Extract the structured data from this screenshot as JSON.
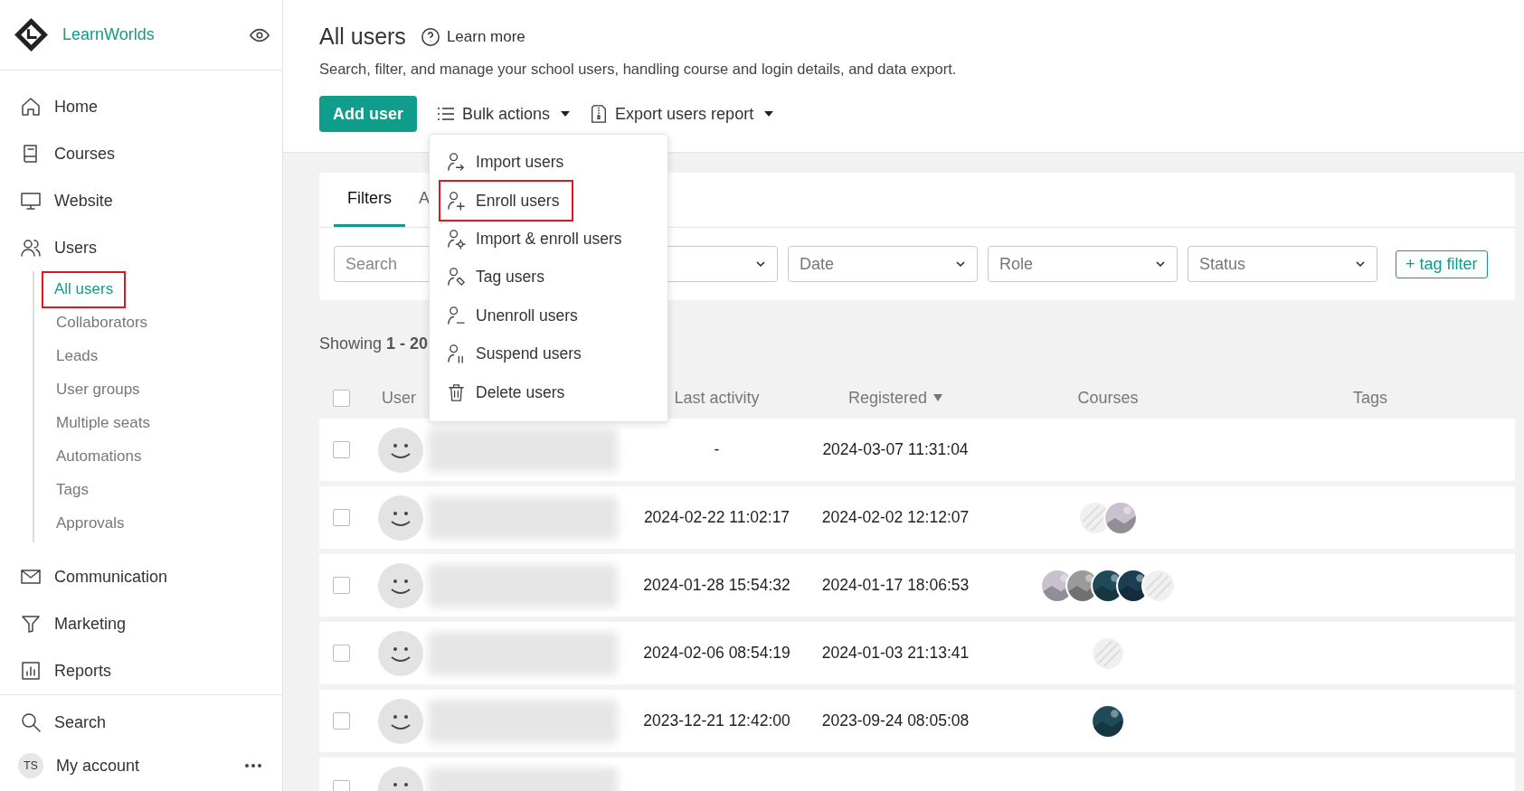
{
  "sidebar": {
    "logo": {
      "text": "LearnWorlds"
    },
    "items": [
      {
        "label": "Home"
      },
      {
        "label": "Courses"
      },
      {
        "label": "Website"
      },
      {
        "label": "Users",
        "expanded": true,
        "children": [
          {
            "label": "All users",
            "selected": true,
            "highlighted": true
          },
          {
            "label": "Collaborators",
            "selected": false,
            "highlighted": false
          },
          {
            "label": "Leads",
            "selected": false,
            "highlighted": false
          },
          {
            "label": "User groups",
            "selected": false,
            "highlighted": false
          },
          {
            "label": "Multiple seats",
            "selected": false,
            "highlighted": false
          },
          {
            "label": "Automations",
            "selected": false,
            "highlighted": false
          },
          {
            "label": "Tags",
            "selected": false,
            "highlighted": false
          },
          {
            "label": "Approvals",
            "selected": false,
            "highlighted": false
          }
        ]
      },
      {
        "label": "Communication"
      },
      {
        "label": "Marketing"
      },
      {
        "label": "Reports"
      }
    ],
    "footer": [
      {
        "label": "Search"
      },
      {
        "label": "My account",
        "initials": "TS"
      }
    ]
  },
  "header": {
    "title": "All users",
    "help_link": "Learn more",
    "description": "Search, filter, and manage your school users, handling course and login details, and data export.",
    "add_button": "Add user",
    "bulk_button": "Bulk actions",
    "export_button": "Export users report"
  },
  "bulk_menu": {
    "open": true,
    "items": [
      {
        "label": "Import users",
        "highlighted": false
      },
      {
        "label": "Enroll users",
        "highlighted": true
      },
      {
        "label": "Import & enroll users",
        "highlighted": false
      },
      {
        "label": "Tag users",
        "highlighted": false
      },
      {
        "label": "Unenroll users",
        "highlighted": false
      },
      {
        "label": "Suspend users",
        "highlighted": false
      },
      {
        "label": "Delete users",
        "highlighted": false
      }
    ]
  },
  "filters": {
    "tabs": [
      {
        "label": "Filters",
        "selected": true
      },
      {
        "label": "A",
        "selected": false
      }
    ],
    "fields": [
      {
        "kind": "search",
        "placeholder": "Search"
      },
      {
        "kind": "select"
      },
      {
        "kind": "select",
        "placeholder": "Date"
      },
      {
        "kind": "select",
        "placeholder": "Role"
      },
      {
        "kind": "select",
        "placeholder": "Status"
      }
    ],
    "tag_filter": "+ tag filter"
  },
  "showing": "Showing **1 - 20**",
  "table": {
    "all_selected": false,
    "columns": [
      {
        "label": "User",
        "sorted": false
      },
      {
        "label": "Last activity",
        "sorted": false
      },
      {
        "label": "Registered",
        "sorted": true
      },
      {
        "label": "Courses",
        "sorted": false
      },
      {
        "label": "Tags",
        "sorted": false
      }
    ],
    "rows": [
      {
        "checked": false,
        "last_activity": "-",
        "registered": "2024-03-07 11:31:04",
        "courses": []
      },
      {
        "checked": false,
        "last_activity": "2024-02-22 11:02:17",
        "registered": "2024-02-02 12:12:07",
        "courses": [
          {
            "kind": "placeholder"
          },
          {
            "kind": "picture"
          }
        ]
      },
      {
        "checked": false,
        "last_activity": "2024-01-28 15:54:32",
        "registered": "2024-01-17 18:06:53",
        "courses": [
          {
            "kind": "picture"
          },
          {
            "kind": "picture"
          },
          {
            "kind": "picture"
          },
          {
            "kind": "picture"
          },
          {
            "kind": "placeholder"
          }
        ]
      },
      {
        "checked": false,
        "last_activity": "2024-02-06 08:54:19",
        "registered": "2024-01-03 21:13:41",
        "courses": [
          {
            "kind": "placeholder"
          }
        ]
      },
      {
        "checked": false,
        "last_activity": "2023-12-21 12:42:00",
        "registered": "2023-09-24 08:05:08",
        "courses": [
          {
            "kind": "picture"
          }
        ]
      },
      {
        "checked": false,
        "courses": []
      }
    ]
  }
}
